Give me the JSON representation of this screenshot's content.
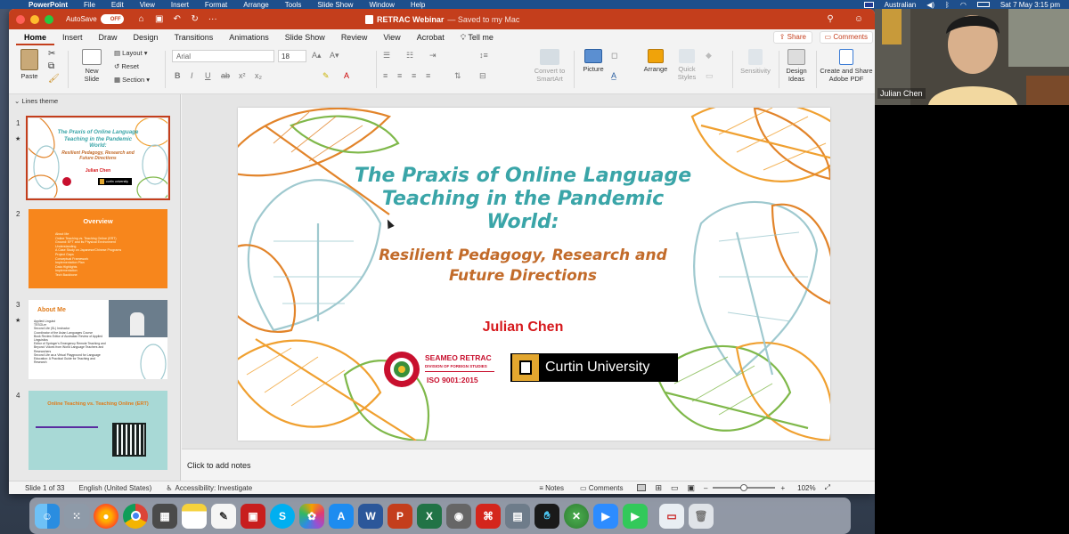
{
  "menubar": {
    "app": "PowerPoint",
    "items": [
      "File",
      "Edit",
      "View",
      "Insert",
      "Format",
      "Arrange",
      "Tools",
      "Slide Show",
      "Window",
      "Help"
    ],
    "input_source": "Australian",
    "clock": "Sat 7 May  3:15 pm"
  },
  "titlebar": {
    "autosave_label": "AutoSave",
    "autosave_state": "OFF",
    "doc_name": "RETRAC Webinar",
    "doc_status": "— Saved to my Mac"
  },
  "ribbon_tabs": [
    "Home",
    "Insert",
    "Draw",
    "Design",
    "Transitions",
    "Animations",
    "Slide Show",
    "Review",
    "View",
    "Acrobat",
    "Tell me"
  ],
  "ribbon_actions": {
    "share": "Share",
    "comments": "Comments"
  },
  "ribbon": {
    "paste": "Paste",
    "new_slide": "New Slide",
    "layout": "Layout",
    "reset": "Reset",
    "section": "Section",
    "font_name": "Arial",
    "font_size": "18",
    "convert_smartart": "Convert to SmartArt",
    "picture": "Picture",
    "arrange": "Arrange",
    "quick_styles": "Quick Styles",
    "sensitivity": "Sensitivity",
    "design_ideas": "Design Ideas",
    "create_share_pdf": "Create and Share Adobe PDF"
  },
  "panel": {
    "theme_label": "Lines theme",
    "slides": [
      {
        "num": "1",
        "title": "The Praxis of Online Language Teaching in the Pandemic World:",
        "subtitle": "Resilient Pedagogy, Research and Future Directions",
        "author": "Julian Chen",
        "logo": "curtin university"
      },
      {
        "num": "2",
        "title": "Overview",
        "lines": [
          "About Me",
          "Online Teaching vs. Teaching Online (ERT)",
          "Ground: EFT and its Physical Environment",
          "Understanding",
          "A Case Study on Japanese/Chinese Programs",
          "Project Gaps",
          "Conceptual Framework",
          "Implementation Plan",
          "Data Highlights",
          "Implementation",
          "Tech Backbone"
        ]
      },
      {
        "num": "3",
        "title": "About Me",
        "lines": [
          "Applied Linguist",
          "TESOLer",
          "Second Life (SL) Instructor",
          "Coordinator of the Asian Languages Course",
          "Book Review Editor of Australian Review of Applied Linguistics",
          "Editor of Springer's Emergency Remote Teaching and Beyond: Voices from World Language Teachers and Researchers",
          "Second Life as a Virtual Playground for Language Education: A Practical Guide for Teaching and Research"
        ]
      },
      {
        "num": "4",
        "title": "Online Teaching vs. Teaching Online (ERT)"
      }
    ]
  },
  "slide": {
    "title": "The Praxis of Online Language Teaching in the Pandemic World:",
    "subtitle": "Resilient Pedagogy, Research and Future Directions",
    "author": "Julian Chen",
    "seameo_name": "SEAMEO RETRAC",
    "seameo_division": "DIVISION OF FOREIGN STUDIES",
    "seameo_iso": "ISO 9001:2015",
    "curtin": "Curtin University"
  },
  "notes_placeholder": "Click to add notes",
  "status": {
    "slide_counter": "Slide 1 of 33",
    "language": "English (United States)",
    "accessibility": "Accessibility: Investigate",
    "notes": "Notes",
    "comments": "Comments",
    "zoom": "102%"
  },
  "video": {
    "participant": "Julian Chen"
  },
  "dock_icons": [
    "finder-icon",
    "launchpad-icon",
    "firefox-icon",
    "chrome-icon",
    "calculator-icon",
    "notes-icon",
    "textedit-icon",
    "photo-booth-icon",
    "skype-icon",
    "photos-icon",
    "app-store-icon",
    "word-icon",
    "powerpoint-icon",
    "excel-icon",
    "screenshot-icon",
    "acrobat-icon",
    "preview-icon",
    "webex-icon",
    "crossover-icon",
    "zoom-icon",
    "facetime-icon",
    "keynote-icon",
    "trash-icon"
  ],
  "colors": {
    "ppt_accent": "#c43e1c",
    "title_teal": "#3aa5a8",
    "subtitle_orange": "#c26b2a",
    "author_red": "#d6181c"
  }
}
